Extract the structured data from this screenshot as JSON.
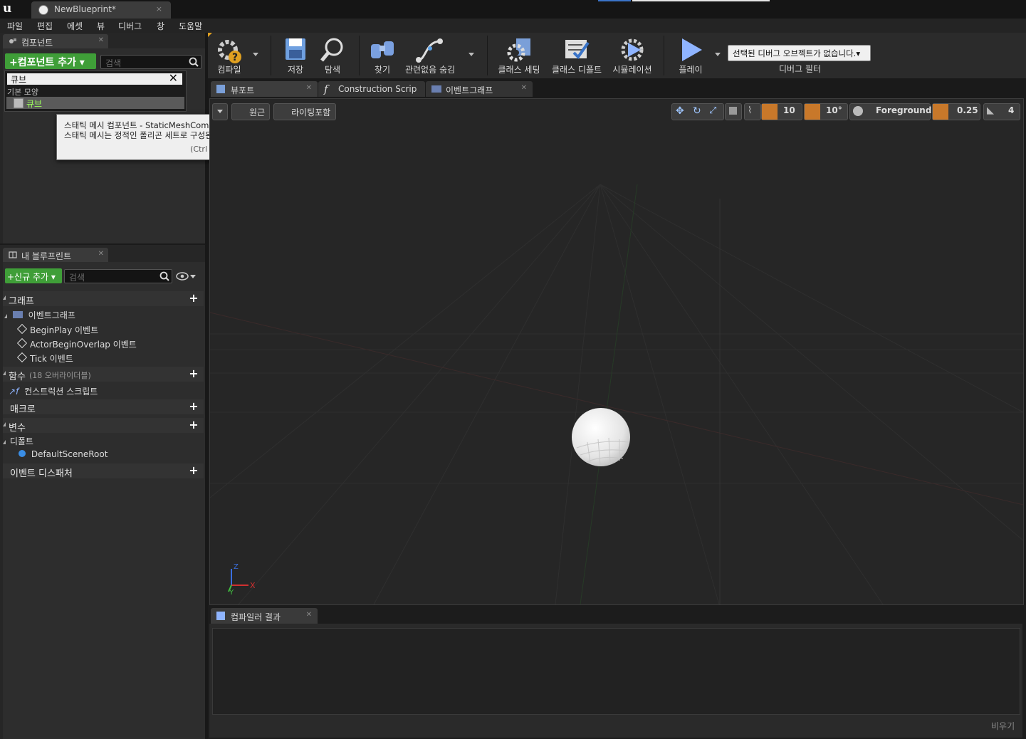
{
  "window": {
    "tab_title": "NewBlueprint*",
    "tab_close": "×",
    "logo": "u"
  },
  "menu": [
    "파일",
    "편집",
    "에셋",
    "뷰",
    "디버그",
    "창",
    "도움말"
  ],
  "components_panel": {
    "tab_label": "컴포넌트",
    "add_button": "+컴포넌트 추가 ▾",
    "search_placeholder": "검색",
    "dropdown_search_value": "큐브",
    "category": "기본 모양",
    "item": "큐브"
  },
  "tooltip": {
    "line1": "스태틱 메시 컴포넌트 - StaticMeshComponent 는 UStaticMesh 의 인스턴스를 만드는 데 사용됩니다.",
    "line2": "스태틱 메시는 정적인 폴리곤 세트로 구성된 지오메트리입니다.",
    "line3": "(Ctrl + Alt) 키를 누르면 상세히"
  },
  "my_blueprint": {
    "tab_label": "내 블루프린트",
    "add_button": "+신규 추가 ▾",
    "search_placeholder": "검색",
    "sections": {
      "graph": "그래프",
      "event_graph": "이벤트그래프",
      "events": [
        "BeginPlay 이벤트",
        "ActorBeginOverlap 이벤트",
        "Tick 이벤트"
      ],
      "functions": "함수",
      "functions_count": "(18 오버라이더블)",
      "construction_script": "컨스트럭션 스크립트",
      "macros": "매크로",
      "variables": "변수",
      "defaults": "디폴트",
      "default_scene_root": "DefaultSceneRoot",
      "event_dispatchers": "이벤트 디스패처"
    }
  },
  "toolbar": {
    "compile": "컴파일",
    "save": "저장",
    "browse": "탐색",
    "find": "찾기",
    "hide_unrelated": "관련없음 숨김",
    "class_settings": "클래스 세팅",
    "class_defaults": "클래스 디폴트",
    "simulation": "시뮬레이션",
    "play": "플레이",
    "debug_object": "선택된 디버그 오브젝트가 없습니다.▾",
    "debug_filter": "디버그 필터"
  },
  "editor_tabs": [
    "뷰포트",
    "Construction Scrip",
    "이벤트그래프"
  ],
  "viewport": {
    "perspective_btn": "원근",
    "lit_btn": "라이팅포함",
    "grid_snap": "10",
    "rot_snap": "10°",
    "layer": "Foreground",
    "scale_snap": "0.25",
    "cam_speed": "4",
    "axis_x": "X",
    "axis_y": "Y",
    "axis_z": "Z"
  },
  "compiler": {
    "tab_label": "컴파일러 결과",
    "clear": "비우기"
  }
}
